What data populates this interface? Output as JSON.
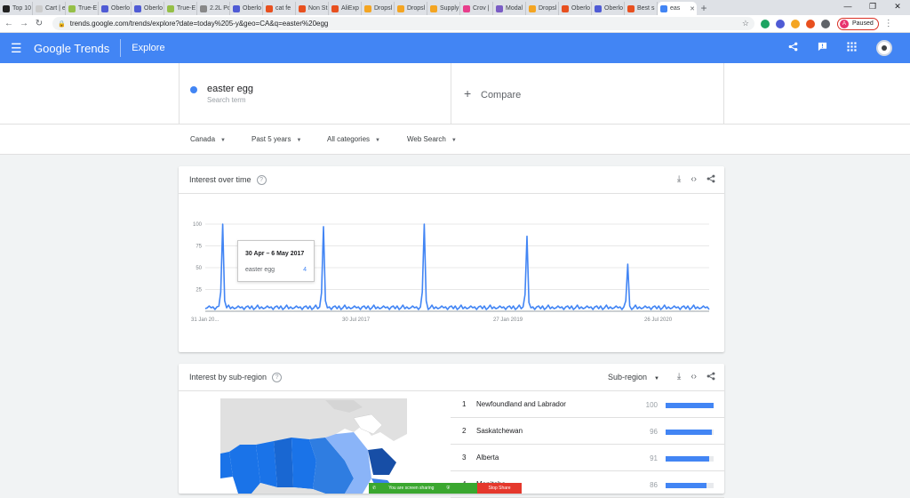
{
  "browser": {
    "tabs": [
      {
        "label": "Top 10",
        "color": "#222222"
      },
      {
        "label": "Cart | e",
        "color": "#cccccc"
      },
      {
        "label": "True-E",
        "color": "#95bf47"
      },
      {
        "label": "Oberlo",
        "color": "#4f5bd5"
      },
      {
        "label": "Oberlo",
        "color": "#4f5bd5"
      },
      {
        "label": "True-E",
        "color": "#95bf47"
      },
      {
        "label": "2.2L Pc",
        "color": "#888888"
      },
      {
        "label": "Oberlo",
        "color": "#4f5bd5"
      },
      {
        "label": "cat fe",
        "color": "#e8501f"
      },
      {
        "label": "Non St",
        "color": "#e8501f"
      },
      {
        "label": "AliExp",
        "color": "#e8501f"
      },
      {
        "label": "Dropsl",
        "color": "#f4a522"
      },
      {
        "label": "Dropsl",
        "color": "#f4a522"
      },
      {
        "label": "Supply",
        "color": "#f4a522"
      },
      {
        "label": "Crov |",
        "color": "#e83e8c"
      },
      {
        "label": "Modal",
        "color": "#7a5cc5"
      },
      {
        "label": "Dropsl",
        "color": "#f4a522"
      },
      {
        "label": "Oberlo",
        "color": "#e8501f"
      },
      {
        "label": "Oberlo",
        "color": "#4f5bd5"
      },
      {
        "label": "Best s",
        "color": "#e8501f"
      },
      {
        "label": "eas",
        "color": "#4285f4",
        "active": true
      }
    ],
    "new_tab": "+",
    "window_controls": [
      "—",
      "❐",
      "✕"
    ],
    "url": "trends.google.com/trends/explore?date=today%205-y&geo=CA&q=easter%20egg",
    "profile_label": "Paused",
    "profile_initial": "A"
  },
  "header": {
    "logo": "Google Trends",
    "section": "Explore"
  },
  "search": {
    "term": "easter egg",
    "term_sublabel": "Search term",
    "compare_label": "Compare"
  },
  "filters": [
    {
      "label": "Canada"
    },
    {
      "label": "Past 5 years"
    },
    {
      "label": "All categories"
    },
    {
      "label": "Web Search"
    }
  ],
  "interest_over_time": {
    "title": "Interest over time",
    "tooltip": {
      "date": "30 Apr – 6 May 2017",
      "term": "easter egg",
      "value": "4"
    }
  },
  "chart_data": {
    "type": "line",
    "title": "Interest over time",
    "ylim": [
      0,
      100
    ],
    "y_ticks": [
      "100",
      "75",
      "50",
      "25"
    ],
    "x_ticks": [
      "31 Jan 20...",
      "30 Jul 2017",
      "27 Jan 2019",
      "26 Jul 2020"
    ],
    "series": [
      {
        "name": "easter egg",
        "color": "#4285f4",
        "weeks": 261,
        "baseline": 4,
        "peaks": [
          {
            "week": 9,
            "value": 100
          },
          {
            "week": 61,
            "value": 97
          },
          {
            "week": 113,
            "value": 100
          },
          {
            "week": 166,
            "value": 86
          },
          {
            "week": 218,
            "value": 54
          }
        ]
      }
    ]
  },
  "sub_region": {
    "title": "Interest by sub-region",
    "selector": "Sub-region",
    "rows": [
      {
        "rank": "1",
        "name": "Newfoundland and Labrador",
        "value": 100
      },
      {
        "rank": "2",
        "name": "Saskatchewan",
        "value": 96
      },
      {
        "rank": "3",
        "name": "Alberta",
        "value": 91
      },
      {
        "rank": "4",
        "name": "Manitoba",
        "value": 86
      }
    ]
  },
  "screen_share": {
    "message": "You are screen sharing",
    "stop": "Stop Share"
  }
}
